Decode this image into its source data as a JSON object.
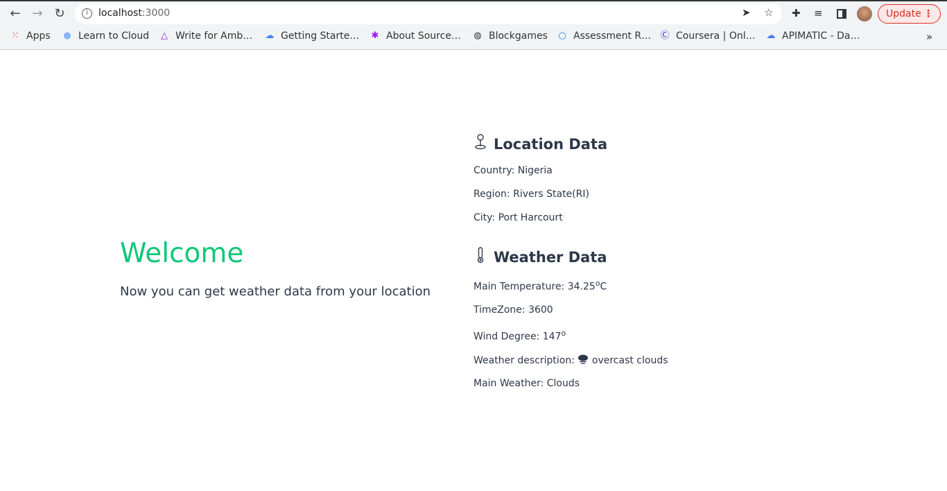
{
  "browser": {
    "url_host": "localhost",
    "url_port": ":3000",
    "update_label": "Update",
    "bookmarks": [
      {
        "label": "Apps",
        "icon": "apps-grid-icon"
      },
      {
        "label": "Learn to Cloud",
        "icon": "cloud-icon"
      },
      {
        "label": "Write for Amb…",
        "icon": "ambassador-logo-icon"
      },
      {
        "label": "Getting Starte…",
        "icon": "google-cloud-icon"
      },
      {
        "label": "About Source…",
        "icon": "sourcegraph-icon"
      },
      {
        "label": "Blockgames",
        "icon": "globe-icon"
      },
      {
        "label": "Assessment R…",
        "icon": "ring-icon"
      },
      {
        "label": "Coursera | Onl…",
        "icon": "coursera-icon"
      },
      {
        "label": "APIMATIC - Da…",
        "icon": "apimatic-cloud-icon"
      }
    ]
  },
  "hero": {
    "title": "Welcome",
    "subtitle": "Now you can get weather data from your location"
  },
  "location": {
    "heading": "Location Data",
    "country": "Country: Nigeria",
    "region": "Region: Rivers State(RI)",
    "city": "City: Port Harcourt"
  },
  "weather": {
    "heading": "Weather Data",
    "temp_label": "Main Temperature: 34.25",
    "temp_deg": "o",
    "temp_unit": "C",
    "timezone": "TimeZone: 3600",
    "wind_label": "Wind Degree: 147",
    "wind_deg": "o",
    "desc_label": "Weather description:",
    "desc_value": "overcast clouds",
    "main": "Main Weather: Clouds"
  },
  "colors": {
    "accent": "#10c878",
    "text": "#2d3748",
    "update": "#d93025"
  }
}
